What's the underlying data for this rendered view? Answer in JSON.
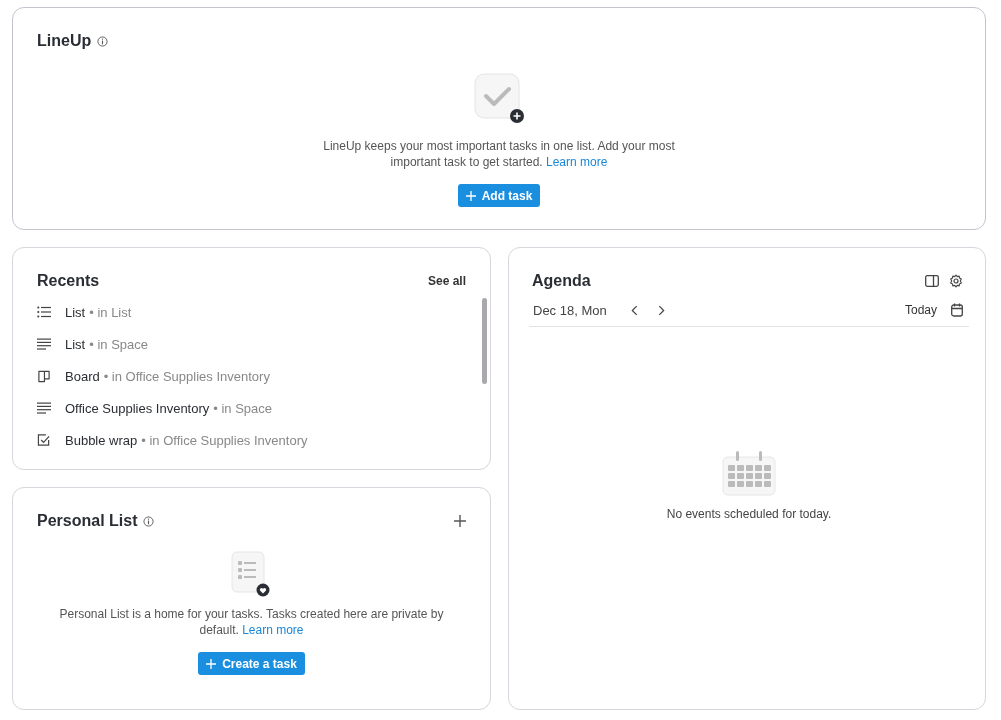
{
  "lineup": {
    "title": "LineUp",
    "description": "LineUp keeps your most important tasks in one list. Add your most important task to get started.",
    "link": "Learn more",
    "button": "Add task"
  },
  "recents": {
    "title": "Recents",
    "see_all": "See all",
    "items": [
      {
        "kind": "bullets",
        "name": "List",
        "location": "• in List"
      },
      {
        "kind": "lines",
        "name": "List",
        "location": "• in Space"
      },
      {
        "kind": "board",
        "name": "Board",
        "location": "• in Office Supplies Inventory"
      },
      {
        "kind": "lines",
        "name": "Office Supplies Inventory",
        "location": "• in Space"
      },
      {
        "kind": "task",
        "name": "Bubble wrap",
        "location": "• in Office Supplies Inventory"
      }
    ]
  },
  "personal_list": {
    "title": "Personal List",
    "description": "Personal List is a home for your tasks. Tasks created here are private by default.",
    "link": "Learn more",
    "button": "Create a task"
  },
  "agenda": {
    "title": "Agenda",
    "date": "Dec 18, Mon",
    "today": "Today",
    "empty": "No events scheduled for today."
  }
}
